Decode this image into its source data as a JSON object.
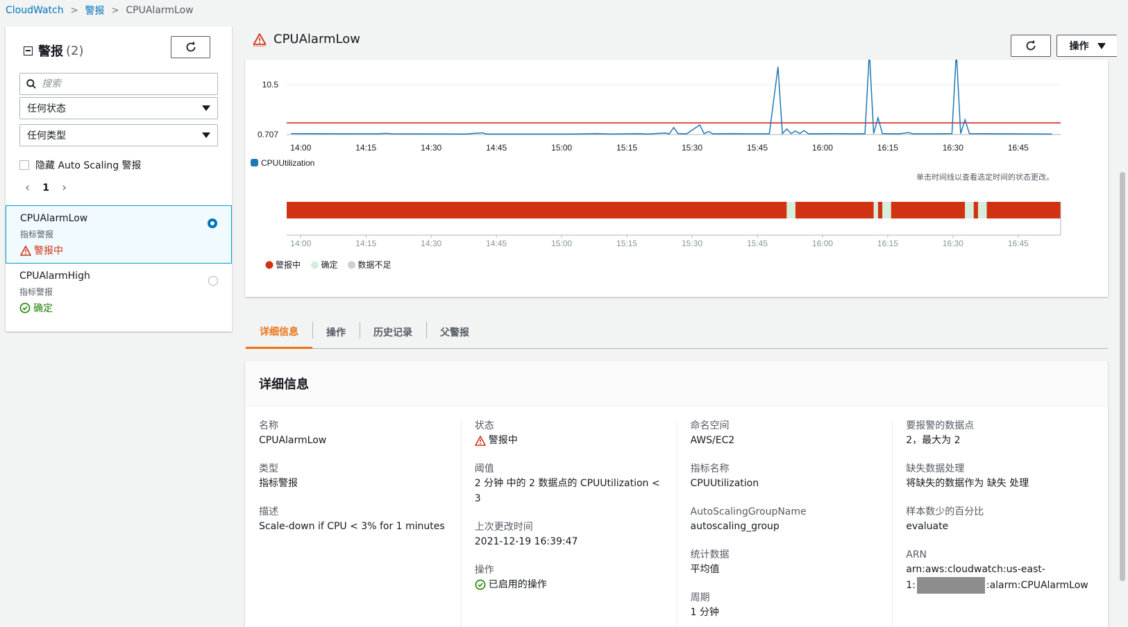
{
  "breadcrumb": {
    "home": "CloudWatch",
    "section": "警报",
    "current": "CPUAlarmLow"
  },
  "sidebar": {
    "title": "警报",
    "count": "(2)",
    "search_placeholder": "搜索",
    "state_filter": "任何状态",
    "type_filter": "任何类型",
    "hide_autoscaling": "隐藏 Auto Scaling 警报",
    "page": "1",
    "alarms": [
      {
        "name": "CPUAlarmLow",
        "type": "指标警报",
        "status": "警报中",
        "selected": true
      },
      {
        "name": "CPUAlarmHigh",
        "type": "指标警报",
        "status": "确定",
        "selected": false
      }
    ]
  },
  "header": {
    "title": "CPUAlarmLow",
    "actions_label": "操作"
  },
  "colors": {
    "alarm": "#d13212",
    "ok": "#1d8102",
    "series": "#1f77b4",
    "threshold": "#d62728",
    "timeline_alarm": "#d13212",
    "timeline_ok": "#d5efdc",
    "timeline_insufficient": "#cfcfcf",
    "accent": "#ec7211",
    "link": "#0073bb"
  },
  "chart_data": [
    {
      "type": "line",
      "ylim": [
        0.707,
        10.5
      ],
      "yticks": [
        "10.5",
        "0.707"
      ],
      "xticks": [
        "14:00",
        "14:15",
        "14:30",
        "14:45",
        "15:00",
        "15:15",
        "15:30",
        "15:45",
        "16:00",
        "16:15",
        "16:30",
        "16:45"
      ],
      "threshold": 3,
      "series": [
        {
          "name": "CPUUtilization",
          "points": [
            [
              "14:00",
              0.9
            ],
            [
              "14:20",
              0.85
            ],
            [
              "14:22",
              0.95
            ],
            [
              "14:23",
              0.85
            ],
            [
              "14:40",
              0.8
            ],
            [
              "14:44",
              1.05
            ],
            [
              "14:45",
              0.8
            ],
            [
              "15:05",
              0.8
            ],
            [
              "15:10",
              0.9
            ],
            [
              "15:14",
              0.8
            ],
            [
              "15:20",
              0.9
            ],
            [
              "15:22",
              0.8
            ],
            [
              "15:26",
              1.0
            ],
            [
              "15:27",
              0.85
            ],
            [
              "15:28",
              2.1
            ],
            [
              "15:29",
              0.9
            ],
            [
              "15:31",
              0.85
            ],
            [
              "15:34",
              2.6
            ],
            [
              "15:35",
              0.9
            ],
            [
              "15:36",
              1.3
            ],
            [
              "15:37",
              0.85
            ],
            [
              "15:42",
              0.9
            ],
            [
              "15:44",
              0.85
            ],
            [
              "15:50",
              0.85
            ],
            [
              "15:52",
              14.0
            ],
            [
              "15:53",
              0.9
            ],
            [
              "15:54",
              1.8
            ],
            [
              "15:55",
              0.9
            ],
            [
              "15:56",
              1.4
            ],
            [
              "15:57",
              0.9
            ],
            [
              "15:58",
              1.5
            ],
            [
              "15:59",
              0.85
            ],
            [
              "16:05",
              0.9
            ],
            [
              "16:10",
              0.85
            ],
            [
              "16:12",
              0.9
            ],
            [
              "16:13",
              17.0
            ],
            [
              "16:14",
              0.9
            ],
            [
              "16:15",
              4.0
            ],
            [
              "16:16",
              0.9
            ],
            [
              "16:20",
              0.85
            ],
            [
              "16:22",
              1.1
            ],
            [
              "16:23",
              0.85
            ],
            [
              "16:28",
              0.85
            ],
            [
              "16:32",
              0.9
            ],
            [
              "16:33",
              17.0
            ],
            [
              "16:34",
              0.9
            ],
            [
              "16:35",
              3.6
            ],
            [
              "16:36",
              0.9
            ],
            [
              "16:45",
              0.85
            ],
            [
              "16:55",
              0.8
            ]
          ]
        }
      ]
    },
    {
      "type": "timeline",
      "note": "单击时间线以查看选定时间的状态更改。",
      "xticks": [
        "14:00",
        "14:15",
        "14:30",
        "14:45",
        "15:00",
        "15:15",
        "15:30",
        "15:45",
        "16:00",
        "16:15",
        "16:30",
        "16:45"
      ],
      "segments": [
        {
          "start": "13:59",
          "end": "15:54",
          "state": "警报中"
        },
        {
          "start": "15:54",
          "end": "15:56",
          "state": "确定"
        },
        {
          "start": "15:56",
          "end": "16:14",
          "state": "警报中"
        },
        {
          "start": "16:14",
          "end": "16:15",
          "state": "确定"
        },
        {
          "start": "16:15",
          "end": "16:16",
          "state": "警报中"
        },
        {
          "start": "16:16",
          "end": "16:18",
          "state": "确定"
        },
        {
          "start": "16:18",
          "end": "16:35",
          "state": "警报中"
        },
        {
          "start": "16:35",
          "end": "16:37",
          "state": "确定"
        },
        {
          "start": "16:37",
          "end": "16:38",
          "state": "警报中"
        },
        {
          "start": "16:38",
          "end": "16:40",
          "state": "确定"
        },
        {
          "start": "16:40",
          "end": "16:57",
          "state": "警报中"
        }
      ],
      "legend": [
        "警报中",
        "确定",
        "数据不足"
      ]
    }
  ],
  "tabs": [
    "详细信息",
    "操作",
    "历史记录",
    "父警报"
  ],
  "details": {
    "title": "详细信息",
    "columns": [
      [
        {
          "label": "名称",
          "value": "CPUAlarmLow"
        },
        {
          "label": "类型",
          "value": "指标警报"
        },
        {
          "label": "描述",
          "value": "Scale-down if CPU < 3% for 1 minutes"
        }
      ],
      [
        {
          "label": "状态",
          "value": "警报中"
        },
        {
          "label": "阈值",
          "value": "2 分钟 中的 2 数据点的 CPUUtilization < 3"
        },
        {
          "label": "上次更改时间",
          "value": "2021-12-19 16:39:47"
        },
        {
          "label": "操作",
          "value": "已启用的操作"
        }
      ],
      [
        {
          "label": "命名空间",
          "value": "AWS/EC2"
        },
        {
          "label": "指标名称",
          "value": "CPUUtilization"
        },
        {
          "label": "AutoScalingGroupName",
          "value": "autoscaling_group"
        },
        {
          "label": "统计数据",
          "value": "平均值"
        },
        {
          "label": "周期",
          "value": "1 分钟"
        }
      ],
      [
        {
          "label": "要报警的数据点",
          "value": "2，最大为 2"
        },
        {
          "label": "缺失数据处理",
          "value": "将缺失的数据作为 缺失 处理"
        },
        {
          "label": "样本数少的百分比",
          "value": "evaluate"
        },
        {
          "label": "ARN",
          "value_line1": "arn:aws:cloudwatch:us-east-",
          "value_prefix": "1:",
          "value_suffix": ":alarm:CPUAlarmLow"
        }
      ]
    ]
  }
}
